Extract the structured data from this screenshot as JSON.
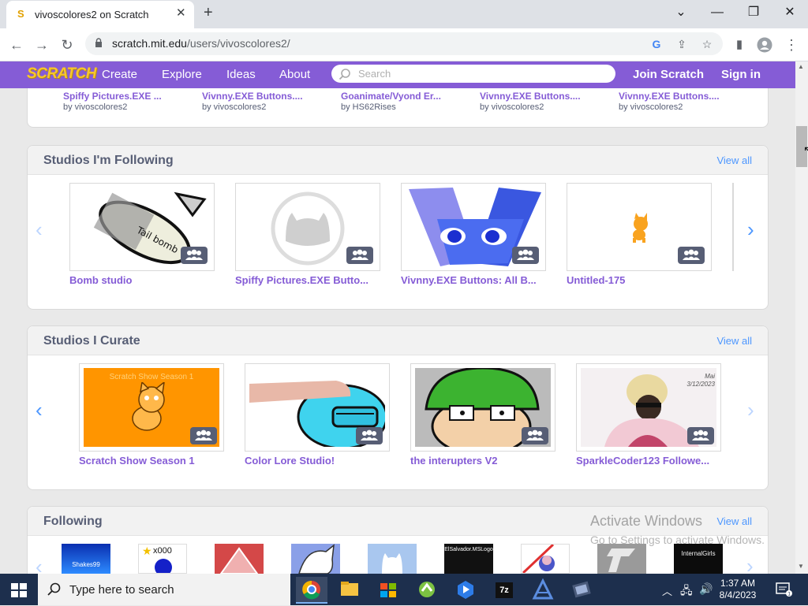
{
  "browser": {
    "tab_title": "vivoscolores2 on Scratch",
    "tab_favicon": "S",
    "new_tab": "+",
    "url_host": "scratch.mit.edu",
    "url_path": "/users/vivoscolores2/"
  },
  "nav": {
    "logo": "SCRATCH",
    "links": [
      "Create",
      "Explore",
      "Ideas",
      "About"
    ],
    "search_placeholder": "Search",
    "join": "Join Scratch",
    "signin": "Sign in"
  },
  "projects_row": {
    "items": [
      {
        "title": "Spiffy Pictures.EXE ...",
        "by": "by vivoscolores2"
      },
      {
        "title": "Vivnny.EXE Buttons....",
        "by": "by vivoscolores2"
      },
      {
        "title": "Goanimate/Vyond Er...",
        "by": "by HS62Rises"
      },
      {
        "title": "Vivnny.EXE Buttons....",
        "by": "by vivoscolores2"
      },
      {
        "title": "Vivnny.EXE Buttons....",
        "by": "by vivoscolores2"
      }
    ]
  },
  "following_studios": {
    "title": "Studios I'm Following",
    "view_all": "View all",
    "items": [
      {
        "label": "Bomb studio"
      },
      {
        "label": "Spiffy Pictures.EXE Butto..."
      },
      {
        "label": "Vivnny.EXE Buttons: All B..."
      },
      {
        "label": "Untitled-175"
      }
    ]
  },
  "curate_studios": {
    "title": "Studios I Curate",
    "view_all": "View all",
    "items": [
      {
        "label": "Scratch Show Season 1",
        "thumb_text": "Scratch Show Season 1"
      },
      {
        "label": "Color Lore Studio!"
      },
      {
        "label": "the interupters V2"
      },
      {
        "label": "SparkleCoder123 Followe...",
        "thumb_text": "Mai 3/12/2023"
      }
    ]
  },
  "following": {
    "title": "Following",
    "view_all": "View all",
    "thumb_texts": [
      "Shakes99",
      "x000",
      "",
      "",
      "",
      "ElSalvador.MSLogo",
      "",
      "",
      "InternalGirls"
    ]
  },
  "watermark": {
    "line1": "Activate Windows",
    "line2": "Go to Settings to activate Windows."
  },
  "taskbar": {
    "search_placeholder": "Type here to search",
    "time": "1:37 AM",
    "date": "8/4/2023"
  },
  "colors": {
    "scratch_purple": "#855cd6",
    "link_blue": "#4d97ff",
    "taskbar": "#1d2f4d"
  }
}
